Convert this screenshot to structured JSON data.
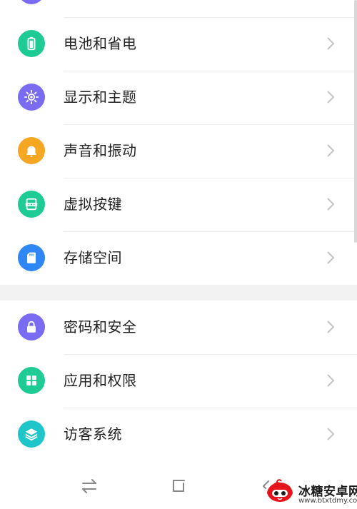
{
  "colors": {
    "background": "#ffffff",
    "divider": "#ececec",
    "group_gap": "#f2f2f2",
    "label": "#222222",
    "chevron": "#c4c4c4",
    "partial_icon": "#7a6cf2"
  },
  "settings_group_1": [
    {
      "label": "电池和省电",
      "icon": "battery-icon",
      "color": "#1ecb94"
    },
    {
      "label": "显示和主题",
      "icon": "sun-icon",
      "color": "#7a6cf2"
    },
    {
      "label": "声音和振动",
      "icon": "bell-icon",
      "color": "#f5a623"
    },
    {
      "label": "虚拟按键",
      "icon": "virtual-keys-icon",
      "color": "#1ecb94"
    },
    {
      "label": "存储空间",
      "icon": "sd-card-icon",
      "color": "#2f87f5"
    }
  ],
  "settings_group_2": [
    {
      "label": "密码和安全",
      "icon": "lock-icon",
      "color": "#7a6cf2"
    },
    {
      "label": "应用和权限",
      "icon": "apps-grid-icon",
      "color": "#1ecb94"
    },
    {
      "label": "访客系统",
      "icon": "layers-icon",
      "color": "#1ec6c9"
    }
  ],
  "navbar": {
    "switch_icon": "swap-arrows-icon",
    "home_icon": "square-home-icon",
    "back_icon": "back-chevron-icon"
  },
  "watermark": {
    "title": "冰糖安卓网",
    "url": "www.btxtdmy.com"
  }
}
